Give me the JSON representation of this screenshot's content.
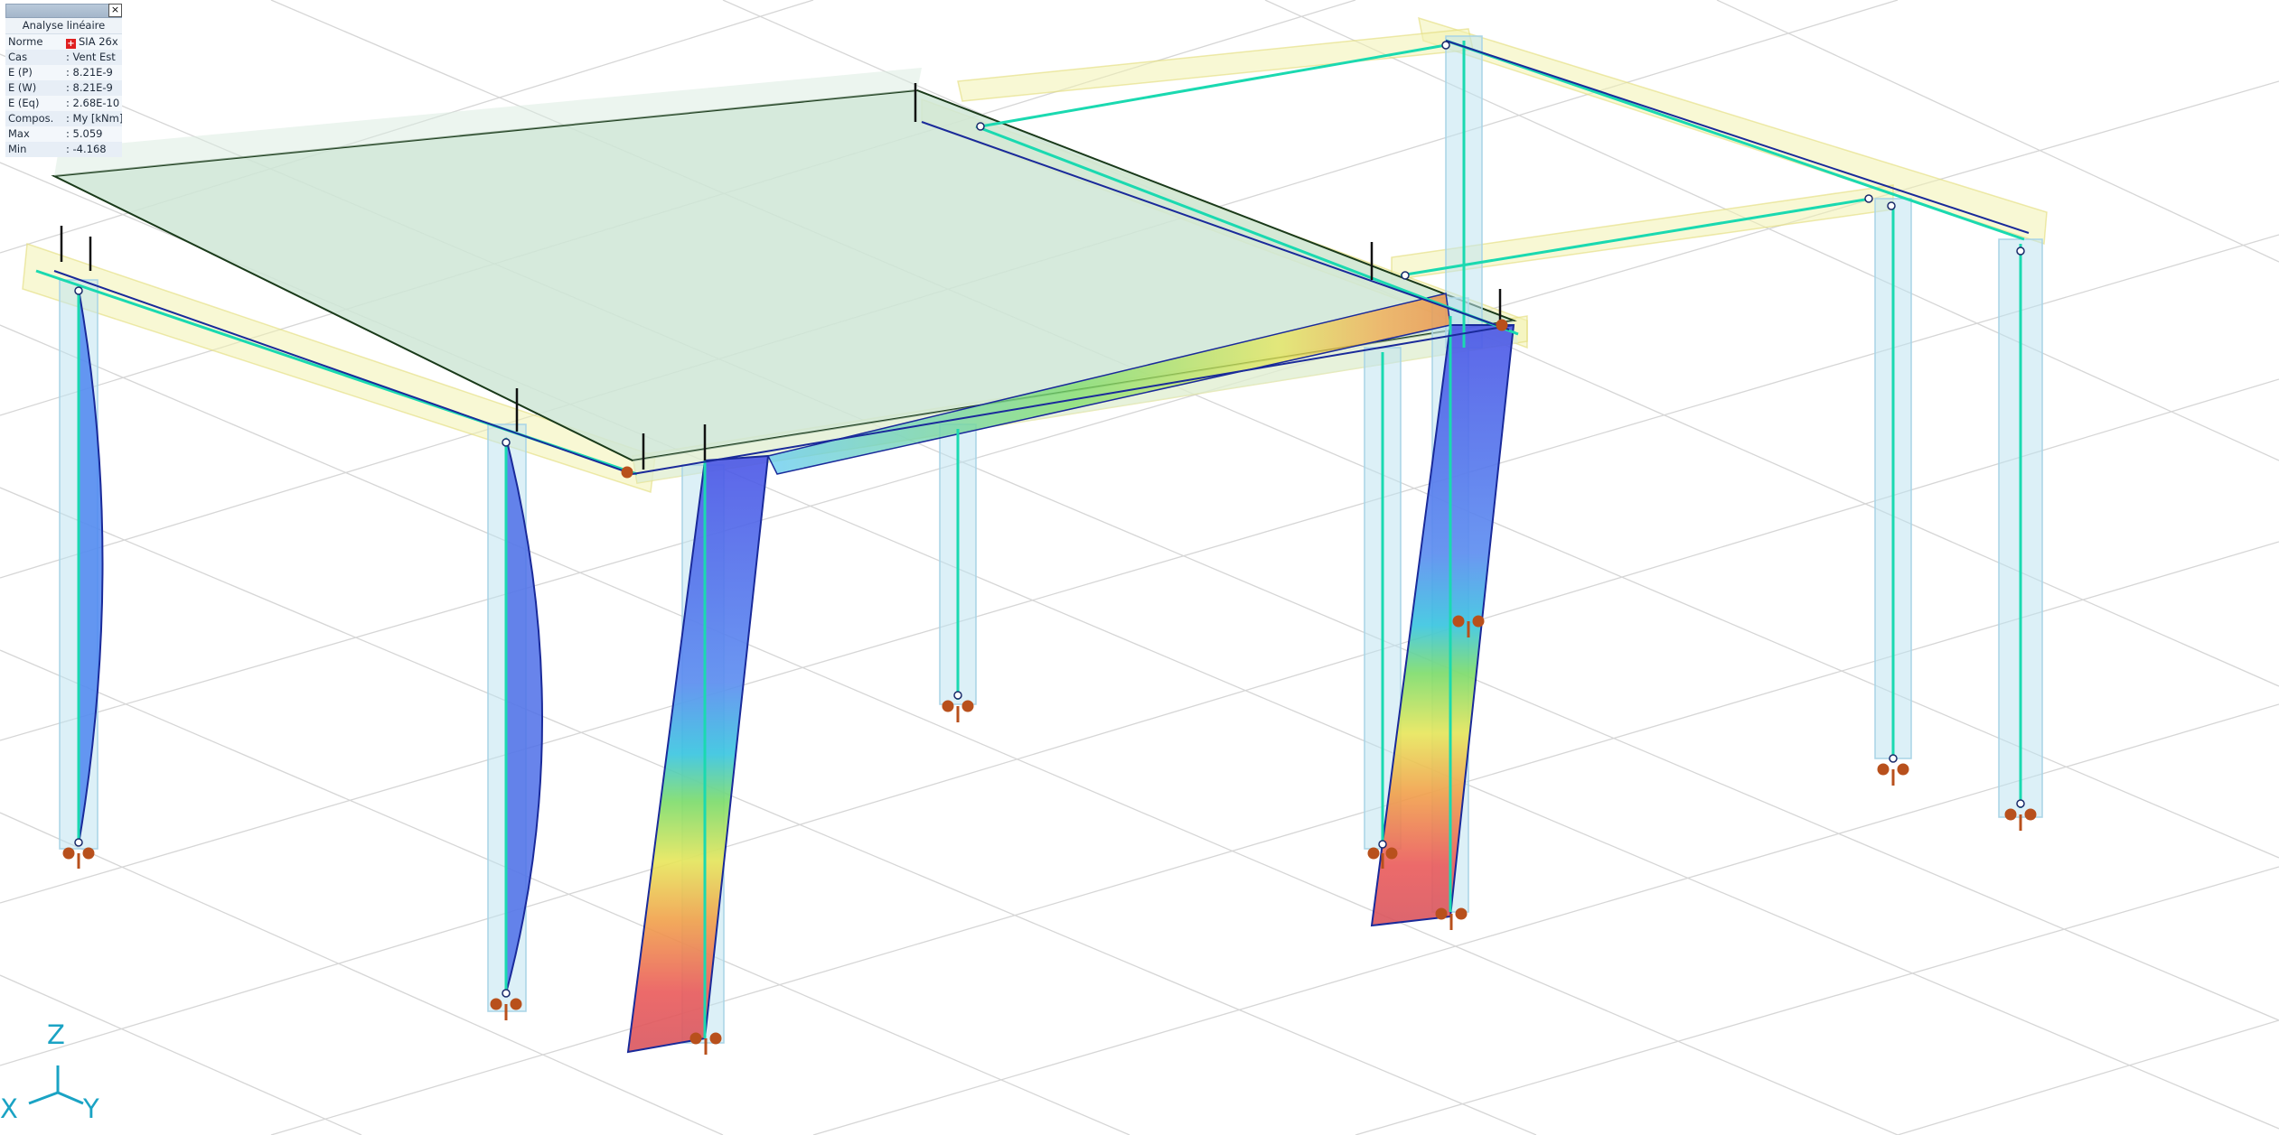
{
  "info_panel": {
    "heading": "Analyse linéaire",
    "close_glyph": "×",
    "rows": [
      {
        "key": "Norme",
        "value": "SIA 26x",
        "icon": "swiss-flag-icon"
      },
      {
        "key": "Cas",
        "value": ": Vent Est"
      },
      {
        "key": "E (P)",
        "value": ": 8.21E-9"
      },
      {
        "key": "E (W)",
        "value": ": 8.21E-9"
      },
      {
        "key": "E (Eq)",
        "value": ": 2.68E-10"
      },
      {
        "key": "Compos.",
        "value": ": My [kNm]"
      },
      {
        "key": "Max",
        "value": ": 5.059"
      },
      {
        "key": "Min",
        "value": ": -4.168"
      }
    ]
  },
  "axes": {
    "z": "Z",
    "x": "X",
    "y": "Y"
  },
  "colors": {
    "slab": "#cfe6d6",
    "beam_band": "#f3f2b0",
    "column_band": "#bfe4f0",
    "member_line": "#1ad9b0",
    "diagram_outline": "#1a2a9a",
    "support": "#b8501c",
    "axis": "#1aa3c4"
  }
}
